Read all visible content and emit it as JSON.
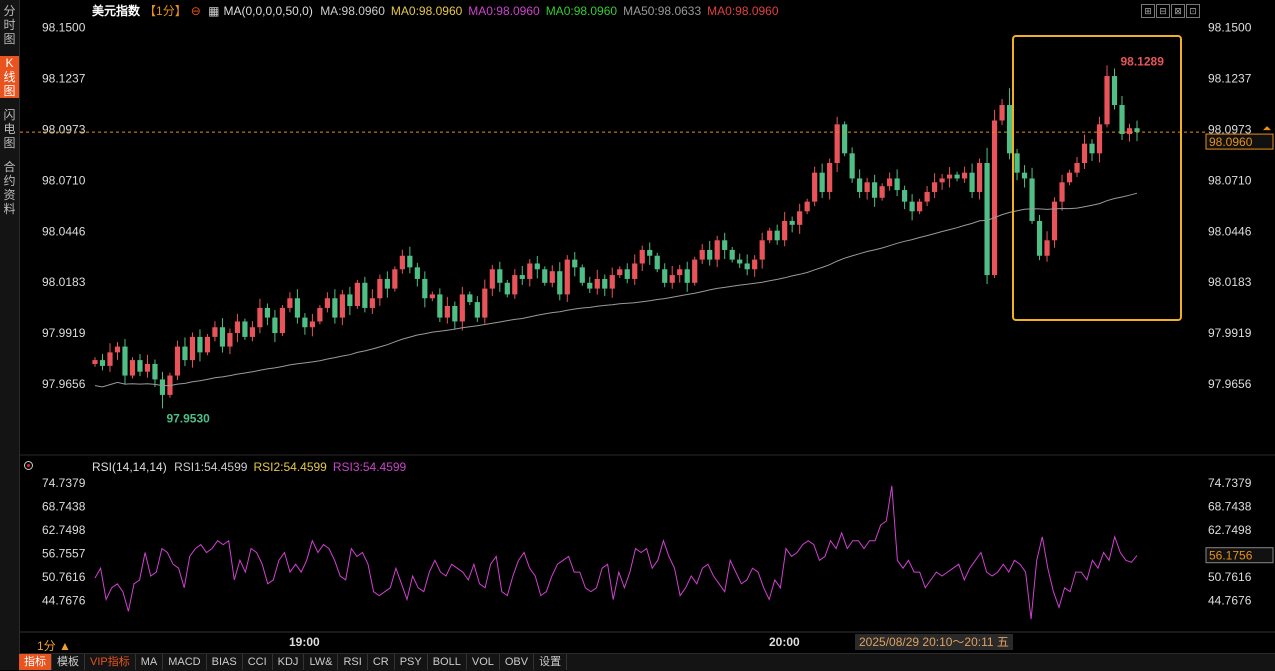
{
  "sidebar": {
    "tabs": [
      {
        "label": "分时图",
        "active": false
      },
      {
        "label": "K线图",
        "active": true
      },
      {
        "label": "闪电图",
        "active": false
      },
      {
        "label": "合约资料",
        "active": false
      }
    ]
  },
  "header": {
    "symbol": "美元指数",
    "period": "【1分】",
    "ma_params": "MA(0,0,0,0,50,0)",
    "ma_values": [
      {
        "label": "MA:98.0960",
        "color": "#cccccc"
      },
      {
        "label": "MA0:98.0960",
        "color": "#e6c84a"
      },
      {
        "label": "MA0:98.0960",
        "color": "#cc44cc"
      },
      {
        "label": "MA0:98.0960",
        "color": "#33cc33"
      },
      {
        "label": "MA50:98.0633",
        "color": "#999999"
      },
      {
        "label": "MA0:98.0960",
        "color": "#e04040"
      }
    ]
  },
  "window_buttons": [
    "⊞",
    "⊟",
    "⊠",
    "⊡"
  ],
  "price_axis": {
    "ticks": [
      "98.1500",
      "98.1237",
      "98.0973",
      "98.0710",
      "98.0446",
      "98.0183",
      "97.9919",
      "97.9656"
    ],
    "current_price": "98.0960",
    "range": [
      97.947,
      98.154
    ]
  },
  "annotations": {
    "high_label": "98.1289",
    "low_label": "97.9530"
  },
  "rsi": {
    "header": "RSI(14,14,14)",
    "values": [
      {
        "label": "RSI1:54.4599",
        "color": "#cccccc"
      },
      {
        "label": "RSI2:54.4599",
        "color": "#e6c84a"
      },
      {
        "label": "RSI3:54.4599",
        "color": "#cc44cc"
      }
    ],
    "ticks": [
      "74.7379",
      "68.7438",
      "62.7498",
      "56.7557",
      "50.7616",
      "44.7676"
    ],
    "current": "56.1756",
    "range": [
      38.5,
      76.0
    ],
    "series": [
      50.5,
      53,
      45,
      48,
      49,
      47,
      42,
      49,
      50,
      57,
      51,
      52,
      58,
      57,
      54,
      53,
      48,
      56,
      58,
      59,
      57,
      58,
      60,
      59,
      60,
      50,
      55,
      52,
      58,
      57,
      54,
      49,
      50,
      55,
      57,
      52,
      54,
      52,
      55,
      60,
      57,
      59,
      58,
      55,
      51,
      50,
      58,
      56,
      57,
      54,
      47,
      46,
      47,
      48,
      53,
      49,
      45,
      51,
      48,
      47,
      52,
      55,
      52,
      51,
      54,
      53,
      52,
      50,
      54,
      49,
      48,
      54,
      56,
      47,
      46,
      51,
      55,
      57,
      53,
      51,
      46,
      47,
      51,
      54,
      55,
      56,
      52,
      52,
      48,
      47,
      48,
      53,
      54,
      45,
      52,
      48,
      52,
      58,
      57,
      58,
      53,
      55,
      60,
      56,
      53,
      46,
      48,
      51,
      49,
      53,
      54,
      51,
      49,
      47,
      55,
      52,
      49,
      50,
      53,
      52,
      48,
      45,
      50,
      48,
      58,
      56,
      57,
      59,
      60,
      59,
      55,
      56,
      60,
      58,
      62,
      58,
      60,
      60,
      58,
      60,
      60,
      64,
      65,
      74,
      55,
      53,
      55,
      52,
      52,
      48,
      50,
      52,
      51,
      52,
      53,
      54,
      50,
      53,
      55,
      57,
      52,
      51,
      52,
      54,
      52,
      55,
      54,
      52,
      40,
      55,
      61,
      53,
      47,
      43,
      48,
      47,
      52,
      52,
      50,
      55,
      53,
      57,
      55,
      61,
      57,
      55,
      54.5,
      56.2
    ]
  },
  "chart_data": {
    "type": "candlestick",
    "title": "美元指数【1分】",
    "y_range": [
      97.947,
      98.154
    ],
    "current_price": 98.096,
    "high": 98.1289,
    "low": 97.953,
    "ma50_start": 97.962,
    "ma50_end": 98.0633,
    "x_time_labels": [
      "19:00",
      "20:00"
    ],
    "ohlc_path": [
      97.978,
      97.975,
      97.982,
      97.985,
      97.97,
      97.978,
      97.972,
      97.976,
      97.968,
      97.96,
      97.97,
      97.985,
      97.978,
      97.99,
      97.982,
      97.99,
      97.995,
      97.985,
      97.992,
      97.998,
      97.99,
      97.995,
      98.005,
      98.0,
      97.992,
      98.005,
      98.01,
      98.0,
      97.995,
      97.998,
      98.005,
      98.01,
      98.0,
      98.012,
      98.006,
      98.018,
      98.005,
      98.01,
      98.02,
      98.015,
      98.025,
      98.032,
      98.026,
      98.02,
      98.01,
      98.012,
      98.0,
      98.006,
      97.998,
      98.012,
      98.008,
      98.0,
      98.015,
      98.025,
      98.018,
      98.012,
      98.022,
      98.02,
      98.028,
      98.025,
      98.018,
      98.024,
      98.012,
      98.03,
      98.026,
      98.018,
      98.015,
      98.02,
      98.015,
      98.022,
      98.025,
      98.02,
      98.028,
      98.035,
      98.032,
      98.025,
      98.018,
      98.022,
      98.025,
      98.018,
      98.03,
      98.035,
      98.03,
      98.04,
      98.035,
      98.03,
      98.028,
      98.025,
      98.03,
      98.04,
      98.045,
      98.04,
      98.05,
      98.048,
      98.055,
      98.06,
      98.075,
      98.065,
      98.08,
      98.1,
      98.085,
      98.072,
      98.065,
      98.07,
      98.062,
      98.068,
      98.072,
      98.066,
      98.06,
      98.055,
      98.06,
      98.065,
      98.07,
      98.072,
      98.074,
      98.072,
      98.075,
      98.065,
      98.08,
      98.022,
      98.102,
      98.11,
      98.085,
      98.075,
      98.072,
      98.05,
      98.032,
      98.04,
      98.06,
      98.07,
      98.075,
      98.08,
      98.09,
      98.085,
      98.1,
      98.125,
      98.11,
      98.095,
      98.098,
      98.096
    ]
  },
  "time_axis": {
    "period_label": "1分 ▲",
    "labels": [
      "19:00",
      "20:00"
    ],
    "range_label": "2025/08/29 20:10～20:11 五"
  },
  "bottom_bar": {
    "items": [
      {
        "label": "指标",
        "active": true,
        "vip": false
      },
      {
        "label": "模板",
        "active": false,
        "vip": false
      },
      {
        "label": "VIP指标",
        "active": false,
        "vip": true
      },
      {
        "label": "MA",
        "active": false,
        "vip": false
      },
      {
        "label": "MACD",
        "active": false,
        "vip": false
      },
      {
        "label": "BIAS",
        "active": false,
        "vip": false
      },
      {
        "label": "CCI",
        "active": false,
        "vip": false
      },
      {
        "label": "KDJ",
        "active": false,
        "vip": false
      },
      {
        "label": "LW&",
        "active": false,
        "vip": false
      },
      {
        "label": "RSI",
        "active": false,
        "vip": false
      },
      {
        "label": "CR",
        "active": false,
        "vip": false
      },
      {
        "label": "PSY",
        "active": false,
        "vip": false
      },
      {
        "label": "BOLL",
        "active": false,
        "vip": false
      },
      {
        "label": "VOL",
        "active": false,
        "vip": false
      },
      {
        "label": "OBV",
        "active": false,
        "vip": false
      },
      {
        "label": "设置",
        "active": false,
        "vip": false
      }
    ]
  },
  "colors": {
    "up": "#e8545a",
    "down": "#4fbf86",
    "ma50": "#9a9a9a",
    "rsi_line": "#d040d0",
    "price_line": "#e8901a",
    "highlight_box": "#f0b020",
    "accent": "#e8531e"
  }
}
